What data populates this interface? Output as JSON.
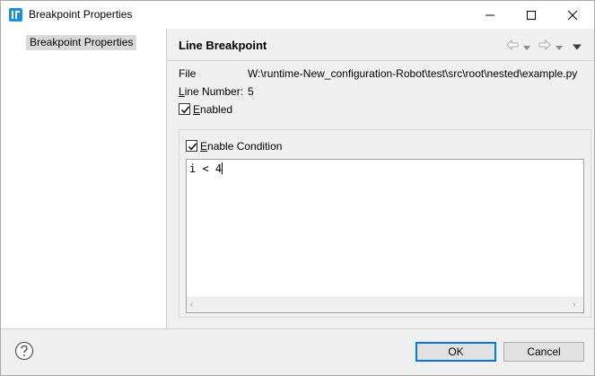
{
  "window": {
    "title": "Breakpoint Properties",
    "icons": {
      "app": "app-icon",
      "minimize": "minimize-icon",
      "maximize": "maximize-icon",
      "close": "close-icon"
    }
  },
  "sidebar": {
    "items": [
      {
        "label": "Breakpoint Properties",
        "selected": true
      }
    ]
  },
  "header": {
    "title": "Line Breakpoint",
    "icons": [
      "back-arrow-icon",
      "dropdown-icon",
      "forward-arrow-icon",
      "dropdown-icon",
      "view-menu-icon"
    ]
  },
  "details": {
    "file_label": "File",
    "file_value": "W:\\runtime-New_configuration-Robot\\test\\src\\root\\nested\\example.py",
    "line_label": "Line Number:",
    "line_value": "5",
    "enabled_label": "Enabled",
    "enabled_checked": true
  },
  "condition": {
    "enable_label": "Enable Condition",
    "enable_checked": true,
    "text": "i < 4"
  },
  "footer": {
    "help_icon": "help-icon",
    "ok_label": "OK",
    "cancel_label": "Cancel"
  },
  "colors": {
    "accent": "#0078d7",
    "app_icon": "#1f8fd6",
    "selection": "#d9d9d9"
  }
}
